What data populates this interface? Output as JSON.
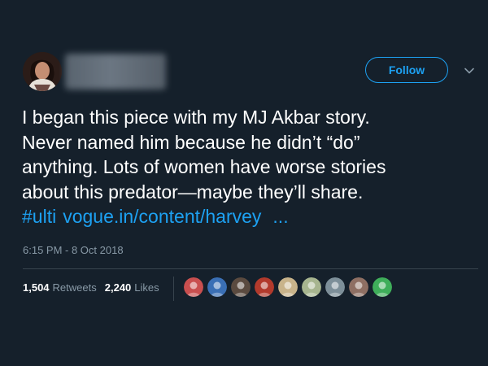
{
  "tweet": {
    "follow_label": "Follow",
    "lines": [
      "I began this piece with my MJ Akbar story.",
      "Never named him because he didn’t “do”",
      "anything. Lots of women have worse stories",
      "about this predator—maybe they’ll share."
    ],
    "hashtag": "#ulti",
    "link_text": "vogue.in/content/harvey",
    "ellipsis": "...",
    "timestamp": "6:15 PM - 8 Oct 2018"
  },
  "stats": {
    "retweets_count": "1,504",
    "retweets_label": "Retweets",
    "likes_count": "2,240",
    "likes_label": "Likes"
  },
  "likers": [
    {
      "icon": "avatar-colorful",
      "color": "#c94f4f"
    },
    {
      "icon": "avatar-blue",
      "color": "#3a6fb5"
    },
    {
      "icon": "avatar-man-beard",
      "color": "#5a4a3f"
    },
    {
      "icon": "avatar-red-emblem",
      "color": "#b23a2c"
    },
    {
      "icon": "avatar-food",
      "color": "#c8b38a"
    },
    {
      "icon": "avatar-flower",
      "color": "#a7b58f"
    },
    {
      "icon": "avatar-person-light",
      "color": "#7d8f99"
    },
    {
      "icon": "avatar-person-glasses",
      "color": "#8e6f63"
    },
    {
      "icon": "avatar-green",
      "color": "#3fae5a"
    }
  ],
  "colors": {
    "background": "#15202b",
    "accent": "#1da1f2",
    "muted": "#8899a6",
    "divider": "#38444d"
  }
}
